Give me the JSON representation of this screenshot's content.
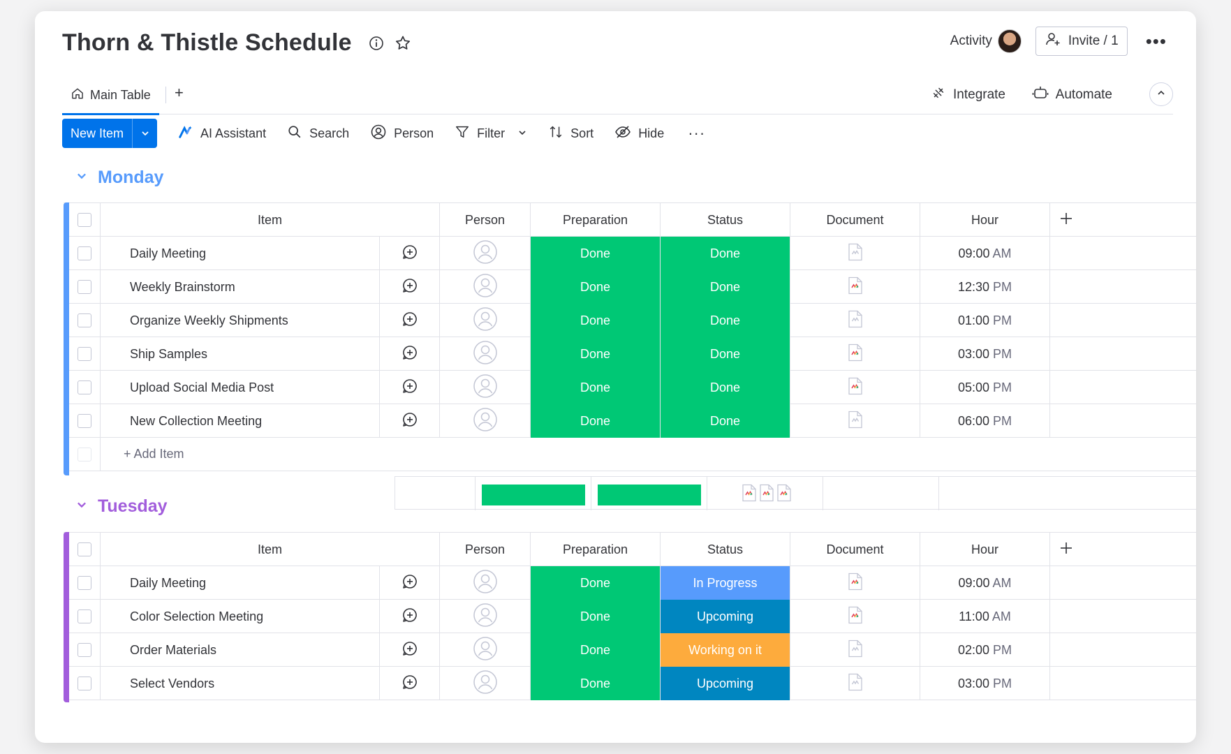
{
  "board": {
    "title": "Thorn & Thistle Schedule",
    "activity_label": "Activity",
    "invite_label": "Invite / 1"
  },
  "tabs": {
    "main_label": "Main Table",
    "add_label": "+",
    "integrate_label": "Integrate",
    "automate_label": "Automate"
  },
  "toolbar": {
    "new_item_label": "New Item",
    "ai_label": "AI Assistant",
    "search_label": "Search",
    "person_label": "Person",
    "filter_label": "Filter",
    "sort_label": "Sort",
    "hide_label": "Hide"
  },
  "columns": {
    "item": "Item",
    "person": "Person",
    "preparation": "Preparation",
    "status": "Status",
    "document": "Document",
    "hour": "Hour"
  },
  "colors": {
    "done": "#00c875",
    "in_progress": "#579bfc",
    "upcoming": "#0086c0",
    "working_on_it": "#fdab3d",
    "monday": "#579bfc",
    "tuesday": "#a25ddc"
  },
  "groups": [
    {
      "name": "Monday",
      "add_item_label": "+ Add Item",
      "rows": [
        {
          "item": "Daily Meeting",
          "preparation": "Done",
          "status": "Done",
          "status_color": "done",
          "doc": "empty",
          "hour": "09:00",
          "ampm": "AM"
        },
        {
          "item": "Weekly Brainstorm",
          "preparation": "Done",
          "status": "Done",
          "status_color": "done",
          "doc": "filled",
          "hour": "12:30",
          "ampm": "PM"
        },
        {
          "item": "Organize Weekly Shipments",
          "preparation": "Done",
          "status": "Done",
          "status_color": "done",
          "doc": "empty",
          "hour": "01:00",
          "ampm": "PM"
        },
        {
          "item": "Ship Samples",
          "preparation": "Done",
          "status": "Done",
          "status_color": "done",
          "doc": "filled",
          "hour": "03:00",
          "ampm": "PM"
        },
        {
          "item": "Upload Social Media Post",
          "preparation": "Done",
          "status": "Done",
          "status_color": "done",
          "doc": "filled",
          "hour": "05:00",
          "ampm": "PM"
        },
        {
          "item": "New Collection Meeting",
          "preparation": "Done",
          "status": "Done",
          "status_color": "done",
          "doc": "empty",
          "hour": "06:00",
          "ampm": "PM"
        }
      ]
    },
    {
      "name": "Tuesday",
      "rows": [
        {
          "item": "Daily Meeting",
          "preparation": "Done",
          "status": "In Progress",
          "status_color": "in_progress",
          "doc": "filled",
          "hour": "09:00",
          "ampm": "AM"
        },
        {
          "item": "Color Selection Meeting",
          "preparation": "Done",
          "status": "Upcoming",
          "status_color": "upcoming",
          "doc": "filled",
          "hour": "11:00",
          "ampm": "AM"
        },
        {
          "item": "Order Materials",
          "preparation": "Done",
          "status": "Working on it",
          "status_color": "working_on_it",
          "doc": "empty",
          "hour": "02:00",
          "ampm": "PM"
        },
        {
          "item": "Select Vendors",
          "preparation": "Done",
          "status": "Upcoming",
          "status_color": "upcoming",
          "doc": "empty",
          "hour": "03:00",
          "ampm": "PM"
        }
      ]
    }
  ]
}
